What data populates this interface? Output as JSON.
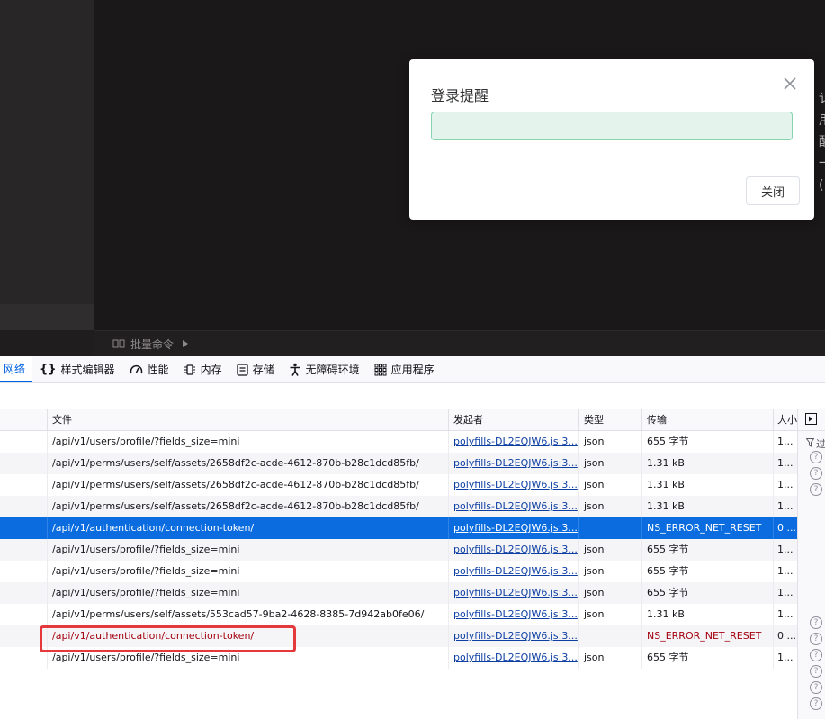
{
  "app": {
    "batch_command_label": "批量命令",
    "right_edge_glyphs": [
      "讠",
      "用",
      "醒",
      "一",
      "("
    ]
  },
  "modal": {
    "title": "登录提醒",
    "alert_text": "",
    "close_button_label": "关闭"
  },
  "devtools": {
    "tabs": [
      {
        "label": "网络",
        "icon": "network-icon"
      },
      {
        "label": "样式编辑器",
        "icon": "braces-icon"
      },
      {
        "label": "性能",
        "icon": "gauge-icon"
      },
      {
        "label": "内存",
        "icon": "memory-chip-icon"
      },
      {
        "label": "存储",
        "icon": "storage-icon"
      },
      {
        "label": "无障碍环境",
        "icon": "accessibility-icon"
      },
      {
        "label": "应用程序",
        "icon": "grid-icon"
      }
    ],
    "columns": {
      "file": "文件",
      "initiator": "发起者",
      "type": "类型",
      "transferred": "传输",
      "size": "大小"
    },
    "side_filter_label": "过",
    "rows": [
      {
        "file": "/api/v1/users/profile/?fields_size=mini",
        "initiator": "polyfills-DL2EQJW6.js:3...",
        "type": "json",
        "transferred": "655 字节",
        "size": "1..."
      },
      {
        "file": "/api/v1/perms/users/self/assets/2658df2c-acde-4612-870b-b28c1dcd85fb/",
        "initiator": "polyfills-DL2EQJW6.js:3...",
        "type": "json",
        "transferred": "1.31 kB",
        "size": "1..."
      },
      {
        "file": "/api/v1/perms/users/self/assets/2658df2c-acde-4612-870b-b28c1dcd85fb/",
        "initiator": "polyfills-DL2EQJW6.js:3...",
        "type": "json",
        "transferred": "1.31 kB",
        "size": "1..."
      },
      {
        "file": "/api/v1/perms/users/self/assets/2658df2c-acde-4612-870b-b28c1dcd85fb/",
        "initiator": "polyfills-DL2EQJW6.js:3...",
        "type": "json",
        "transferred": "1.31 kB",
        "size": "1..."
      },
      {
        "file": "/api/v1/authentication/connection-token/",
        "initiator": "polyfills-DL2EQJW6.js:3...",
        "type": "",
        "transferred": "NS_ERROR_NET_RESET",
        "size": "0 ..."
      },
      {
        "file": "/api/v1/users/profile/?fields_size=mini",
        "initiator": "polyfills-DL2EQJW6.js:3...",
        "type": "json",
        "transferred": "655 字节",
        "size": "1..."
      },
      {
        "file": "/api/v1/users/profile/?fields_size=mini",
        "initiator": "polyfills-DL2EQJW6.js:3...",
        "type": "json",
        "transferred": "655 字节",
        "size": "1..."
      },
      {
        "file": "/api/v1/users/profile/?fields_size=mini",
        "initiator": "polyfills-DL2EQJW6.js:3...",
        "type": "json",
        "transferred": "655 字节",
        "size": "1..."
      },
      {
        "file": "/api/v1/perms/users/self/assets/553cad57-9ba2-4628-8385-7d942ab0fe06/",
        "initiator": "polyfills-DL2EQJW6.js:3...",
        "type": "json",
        "transferred": "1.31 kB",
        "size": "1..."
      },
      {
        "file": "/api/v1/authentication/connection-token/",
        "initiator": "polyfills-DL2EQJW6.js:3...",
        "type": "",
        "transferred": "NS_ERROR_NET_RESET",
        "size": "0 ..."
      },
      {
        "file": "/api/v1/users/profile/?fields_size=mini",
        "initiator": "polyfills-DL2EQJW6.js:3...",
        "type": "json",
        "transferred": "655 字节",
        "size": "1..."
      }
    ],
    "colors": {
      "selected_row": "#0a6cdf",
      "error_text": "#a4000f",
      "highlight_box": "#e5383b",
      "active_tab": "#0061e0"
    }
  }
}
